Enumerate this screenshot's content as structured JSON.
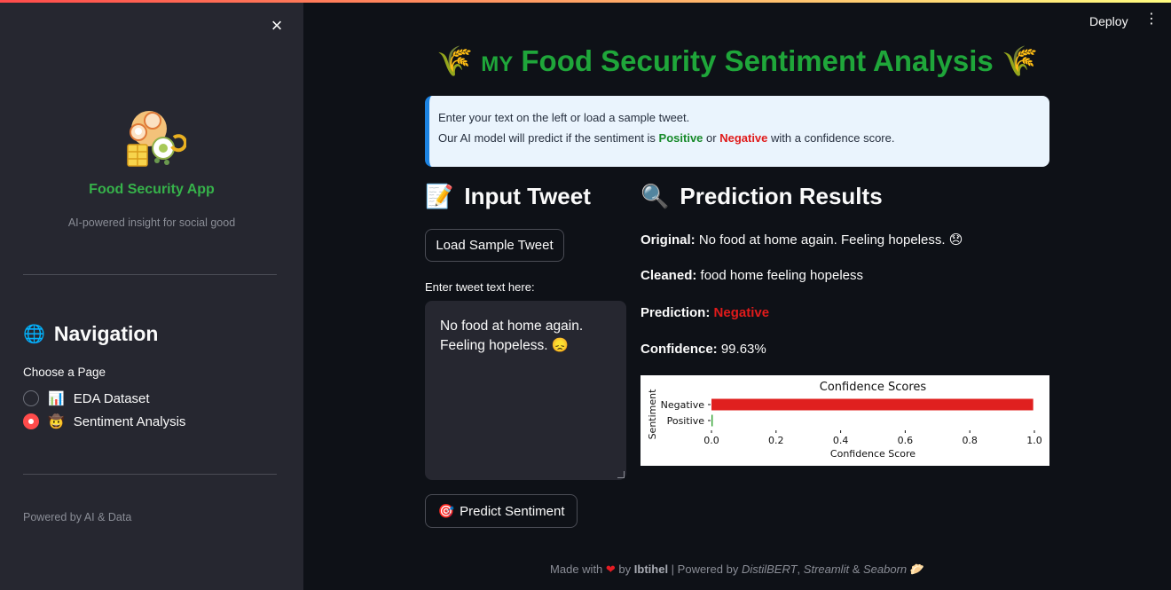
{
  "sidebar": {
    "close_icon": "×",
    "app_name": "Food Security App",
    "tagline": "AI-powered insight for social good",
    "nav_icon": "🌐",
    "nav_title": "Navigation",
    "choose_label": "Choose a Page",
    "pages": [
      {
        "icon": "📊",
        "label": "EDA Dataset",
        "selected": false
      },
      {
        "icon": "🤠",
        "label": "Sentiment Analysis",
        "selected": true
      }
    ],
    "powered": "Powered by AI & Data"
  },
  "header": {
    "deploy": "Deploy",
    "menu_icon": "⋮"
  },
  "main": {
    "title_icon": "🌾",
    "title_prefix": "MY",
    "title": "Food Security Sentiment Analysis",
    "info": {
      "line1": "Enter your text on the left or load a sample tweet.",
      "line2_a": "Our AI model will predict if the sentiment is ",
      "positive": "Positive",
      "or": " or ",
      "negative": "Negative",
      "line2_b": " with a confidence score."
    },
    "input_section": {
      "icon": "📝",
      "title": "Input Tweet",
      "load_button": "Load Sample Tweet",
      "textarea_label": "Enter tweet text here:",
      "textarea_value": "No food at home again. Feeling hopeless. 😞",
      "predict_icon": "🎯",
      "predict_button": "Predict Sentiment"
    },
    "results_section": {
      "icon": "🔍",
      "title": "Prediction Results",
      "original_label": "Original:",
      "original_value": "No food at home again. Feeling hopeless. 😞",
      "cleaned_label": "Cleaned:",
      "cleaned_value": "food home feeling hopeless",
      "prediction_label": "Prediction:",
      "prediction_value": "Negative",
      "confidence_label": "Confidence:",
      "confidence_value": "99.63%"
    }
  },
  "chart_data": {
    "type": "bar",
    "orientation": "horizontal",
    "title": "Confidence Scores",
    "xlabel": "Confidence Score",
    "ylabel": "Sentiment",
    "categories": [
      "Negative",
      "Positive"
    ],
    "values": [
      0.9963,
      0.0037
    ],
    "colors": [
      "#e0201f",
      "#2ca02c"
    ],
    "xlim": [
      0,
      1.0
    ],
    "xticks": [
      "0.0",
      "0.2",
      "0.4",
      "0.6",
      "0.8",
      "1.0"
    ]
  },
  "footer": {
    "made_with": "Made with ",
    "heart": "❤",
    "by": " by ",
    "author": "Ibtihel",
    "powered_by": " | Powered by ",
    "tech1": "DistilBERT",
    "sep": ", ",
    "tech2": "Streamlit",
    "amp": " & ",
    "tech3": "Seaborn",
    "end_icon": "🥟"
  },
  "colors": {
    "accent": "#ff4b4b",
    "title_green": "#1fa63a",
    "negative": "#e01b1b",
    "positive": "#178a2a"
  }
}
